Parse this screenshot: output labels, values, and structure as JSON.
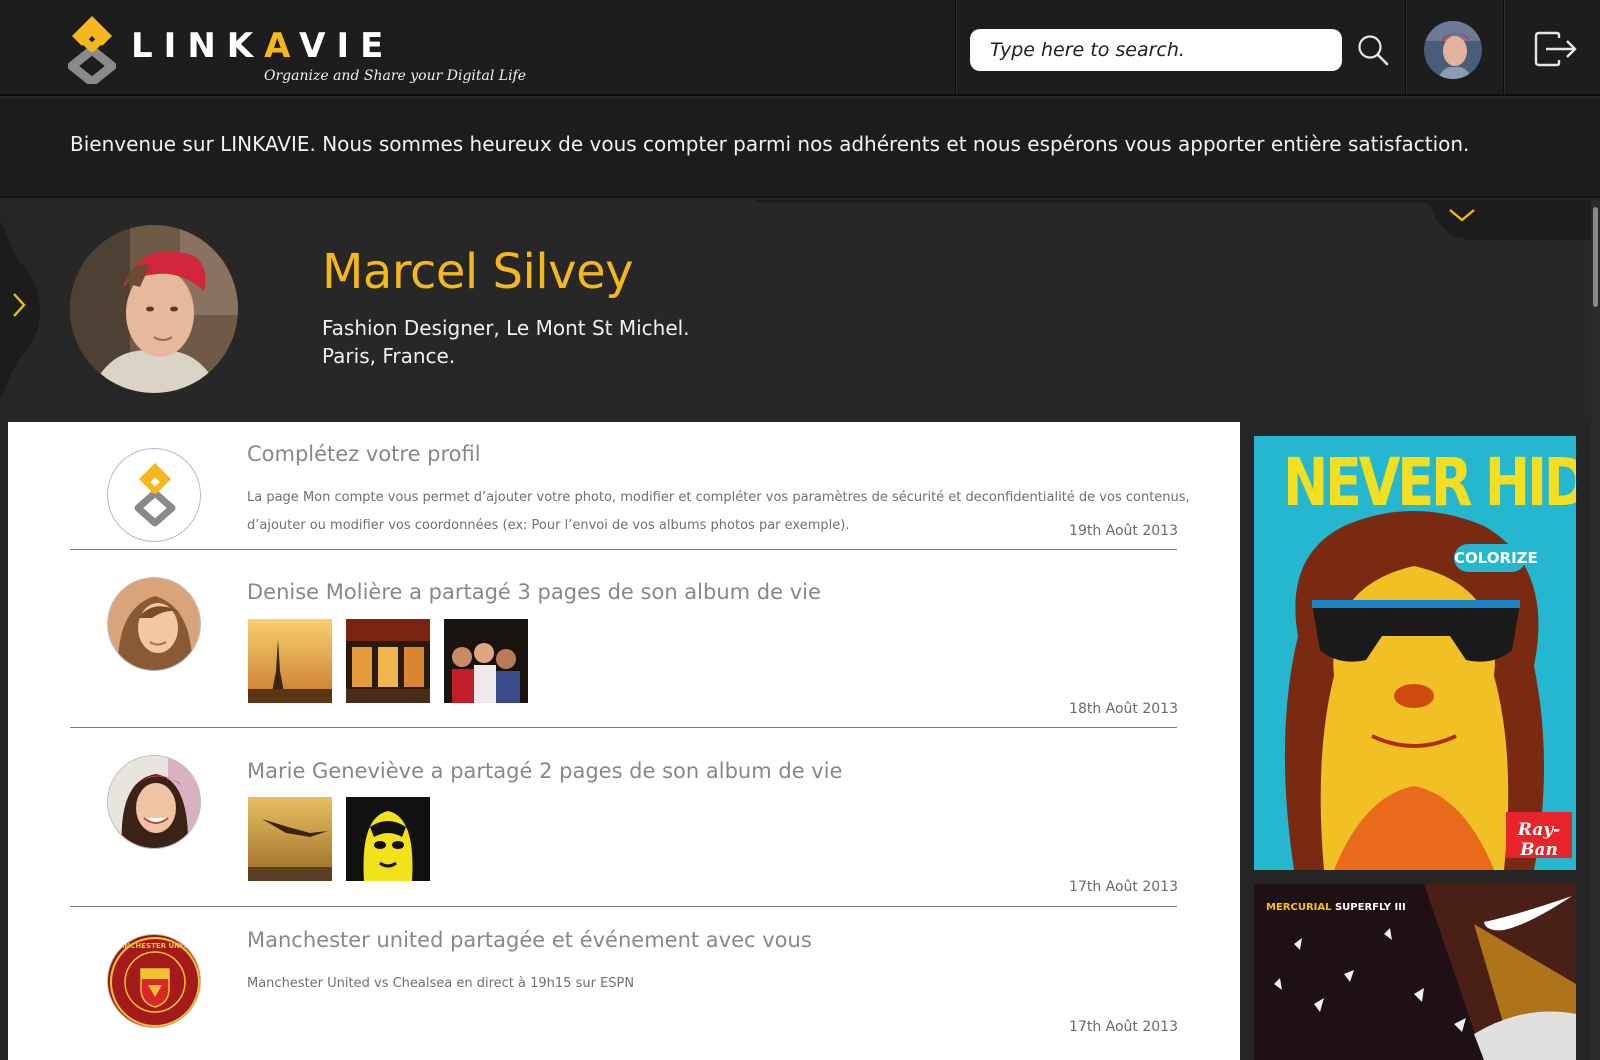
{
  "header": {
    "brand": {
      "pre": "LINK",
      "accent": "A",
      "post": "VIE"
    },
    "tagline": "Organize and Share your Digital Life",
    "search": {
      "placeholder": "Type here to search.",
      "value": ""
    },
    "icons": {
      "search": "search-icon",
      "logout": "logout-icon",
      "collapse": "chevron-down-icon",
      "side": "chevron-right-icon"
    }
  },
  "welcome": {
    "message": "Bienvenue sur LINKAVIE. Nous sommes heureux de vous compter parmi nos adhérents et nous espérons vous apporter entière satisfaction."
  },
  "profile": {
    "name": "Marcel Silvey",
    "occupation": "Fashion Designer, Le Mont St Michel.",
    "location": "Paris, France."
  },
  "feed": [
    {
      "title": "Complétez votre profil",
      "body": "La page Mon compte  vous permet d’ajouter votre photo, modifier et compléter vos paramètres de sécurité et deconfidentialité de vos contenus, d’ajouter ou modifier vos coordonnées (ex: Pour l’envoi de vos albums photos par exemple).",
      "date": "19th Août 2013"
    },
    {
      "title": "Denise Molière a partagé 3 pages de son album de vie",
      "date": "18th Août 2013"
    },
    {
      "title": "Marie Geneviève a partagé 2 pages de son album de vie",
      "date": "17th Août 2013"
    },
    {
      "title": "Manchester united partagée et événement avec vous",
      "body": "Manchester United vs Chealsea en direct à 19h15 sur ESPN",
      "date": "17th Août 2013",
      "crest_text": "MANCHESTER UNITED"
    }
  ],
  "ads": [
    {
      "headline": "NEVER HIDE",
      "badge": "COLORIZE",
      "brand": "Ray-Ban"
    },
    {
      "title_accent": "MERCURIAL",
      "title_rest": " SUPERFLY III"
    }
  ],
  "colors": {
    "accent": "#f5b81c",
    "background": "#252525",
    "topbar": "#1d1d1d",
    "feed": "#ffffff"
  }
}
